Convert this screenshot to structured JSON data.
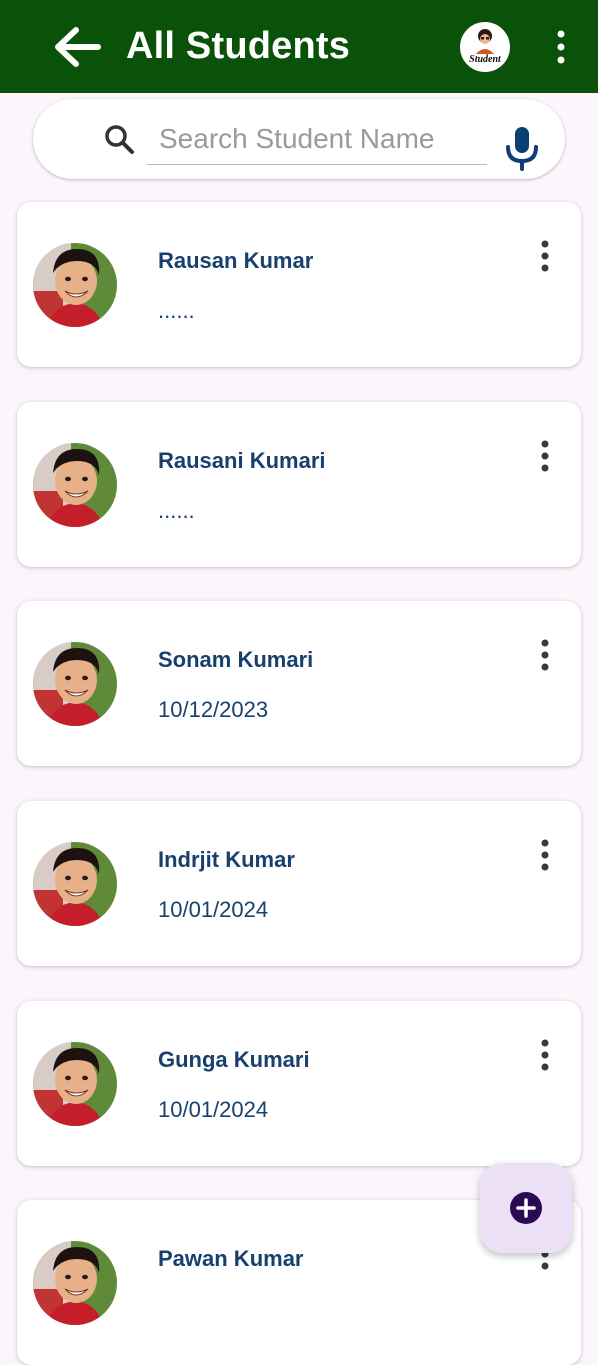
{
  "app_bar": {
    "title": "All Students",
    "logo_text": "Student",
    "icons": [
      "back-arrow-icon",
      "logo",
      "more-vert-icon"
    ],
    "color": "#0a520a"
  },
  "search": {
    "placeholder": "Search Student Name",
    "value": "",
    "icons": [
      "search-icon",
      "mic-icon"
    ]
  },
  "students": [
    {
      "name": "Rausan Kumar",
      "detail": "......"
    },
    {
      "name": "Rausani Kumari",
      "detail": "......"
    },
    {
      "name": "Sonam Kumari",
      "detail": " 10/12/2023"
    },
    {
      "name": "Indrjit Kumar",
      "detail": "10/01/2024"
    },
    {
      "name": "Gunga Kumari",
      "detail": "10/01/2024"
    },
    {
      "name": "Pawan Kumar",
      "detail": ""
    }
  ],
  "fab": {
    "icon": "add-circle-icon",
    "color": "#2a0a55"
  },
  "colors": {
    "text_primary": "#18406e",
    "background": "#fcf5fc"
  }
}
